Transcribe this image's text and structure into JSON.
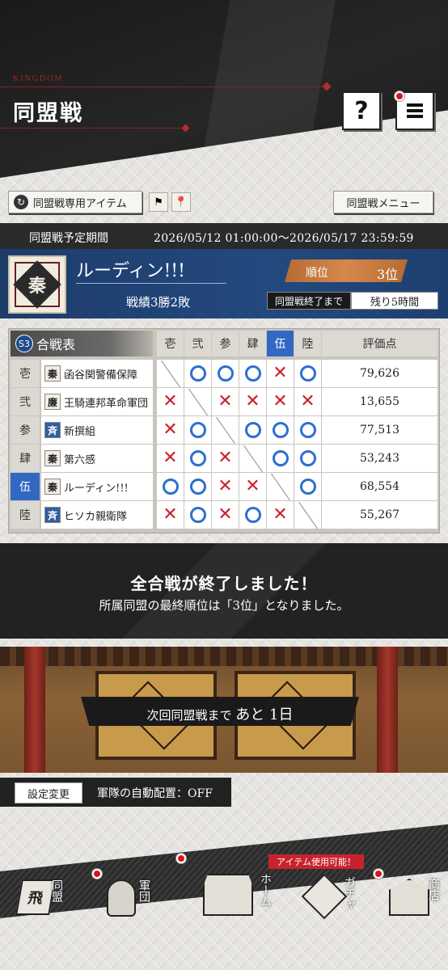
{
  "header": {
    "brand": "KINGDOM",
    "title": "同盟戦",
    "help_label": "?"
  },
  "toolbar": {
    "items_label": "同盟戦専用アイテム",
    "menu_label": "同盟戦メニュー"
  },
  "period": {
    "label": "同盟戦予定期間",
    "value": "2026/05/12 01:00:00～2026/05/17 23:59:59"
  },
  "alliance": {
    "emblem_char": "秦",
    "name": "ルーディン!!!",
    "record": "戦績3勝2敗",
    "rank_label": "順位",
    "rank_value": "3位",
    "end_label": "同盟戦終了まで",
    "end_value": "残り5時間"
  },
  "battle_table": {
    "season": "S3",
    "title": "合戦表",
    "columns": [
      "壱",
      "弐",
      "参",
      "肆",
      "伍",
      "陸"
    ],
    "score_header": "評価点",
    "active_index": 4,
    "rows": [
      {
        "num": "壱",
        "emblem": "秦",
        "name": "函谷関警備保障",
        "results": [
          "-",
          "o",
          "o",
          "o",
          "x",
          "o"
        ],
        "score": "79,626"
      },
      {
        "num": "弐",
        "emblem": "廉",
        "name": "王騎連邦革命軍団",
        "results": [
          "x",
          "-",
          "x",
          "x",
          "x",
          "x"
        ],
        "score": "13,655"
      },
      {
        "num": "参",
        "emblem": "斉",
        "name": "新撰組",
        "results": [
          "x",
          "o",
          "-",
          "o",
          "o",
          "o"
        ],
        "score": "77,513"
      },
      {
        "num": "肆",
        "emblem": "秦",
        "name": "第六感",
        "results": [
          "x",
          "o",
          "x",
          "-",
          "o",
          "o"
        ],
        "score": "53,243"
      },
      {
        "num": "伍",
        "emblem": "秦",
        "name": "ルーディン!!!",
        "results": [
          "o",
          "o",
          "x",
          "x",
          "-",
          "o"
        ],
        "score": "68,554"
      },
      {
        "num": "陸",
        "emblem": "斉",
        "name": "ヒソカ親衛隊",
        "results": [
          "x",
          "o",
          "x",
          "o",
          "x",
          "-"
        ],
        "score": "55,267"
      }
    ]
  },
  "banner": {
    "main": "全合戦が終了しました！",
    "sub": "所属同盟の最終順位は「3位」となりました。"
  },
  "next": {
    "prefix": "次回同盟戦まで",
    "value": "あと 1日"
  },
  "settings": {
    "button_label": "設定変更",
    "text": "軍隊の自動配置：OFF"
  },
  "nav": {
    "item_usable": "アイテム使用可能！",
    "items": [
      {
        "label": "同盟",
        "icon": "飛"
      },
      {
        "label": "軍団"
      },
      {
        "label": "ホーム"
      },
      {
        "label": "ガチャ"
      },
      {
        "label": "商店"
      }
    ]
  },
  "colors": {
    "accent_red": "#c8232d",
    "circle_blue": "#2c6fd1",
    "alliance_blue": "#23497f",
    "rank_orange": "#d4884c"
  }
}
